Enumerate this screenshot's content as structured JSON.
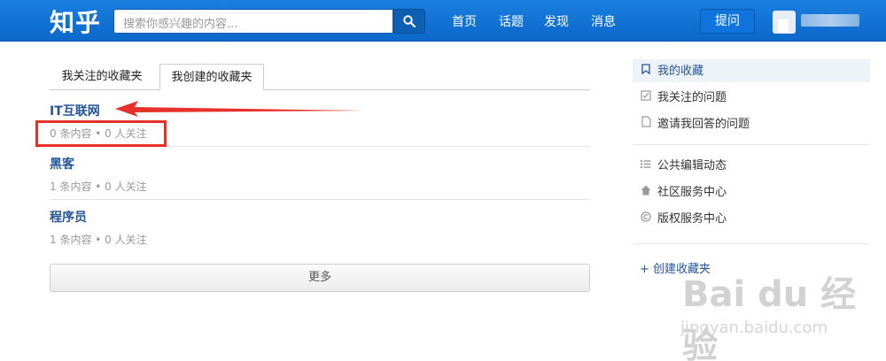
{
  "header": {
    "logo": "知乎",
    "search_placeholder": "搜索你感兴趣的内容...",
    "nav": [
      "首页",
      "话题",
      "发现",
      "消息"
    ],
    "ask_label": "提问",
    "colors": {
      "bar": "#1a7fe0",
      "link": "#225599",
      "annotation": "#e8302a"
    }
  },
  "tabs": [
    {
      "label": "我关注的收藏夹",
      "active": false
    },
    {
      "label": "我创建的收藏夹",
      "active": true
    }
  ],
  "collections": [
    {
      "title": "IT互联网",
      "meta": "0 条内容 • 0 人关注"
    },
    {
      "title": "黑客",
      "meta": "1 条内容 • 0 人关注"
    },
    {
      "title": "程序员",
      "meta": "1 条内容 • 0 人关注"
    }
  ],
  "more_label": "更多",
  "sidebar": {
    "items": [
      {
        "icon": "bookmark-icon",
        "label": "我的收藏",
        "active": true
      },
      {
        "icon": "checkbox-icon",
        "label": "我关注的问题",
        "active": false
      },
      {
        "icon": "document-icon",
        "label": "邀请我回答的问题",
        "active": false
      },
      {
        "icon": "list-icon",
        "label": "公共编辑动态",
        "active": false
      },
      {
        "icon": "home-icon",
        "label": "社区服务中心",
        "active": false
      },
      {
        "icon": "copyright-icon",
        "label": "版权服务中心",
        "active": false
      }
    ],
    "create_label": "+ 创建收藏夹"
  },
  "watermark": {
    "brand": "Bai du 经验",
    "url": "jingyan.baidu.com"
  }
}
